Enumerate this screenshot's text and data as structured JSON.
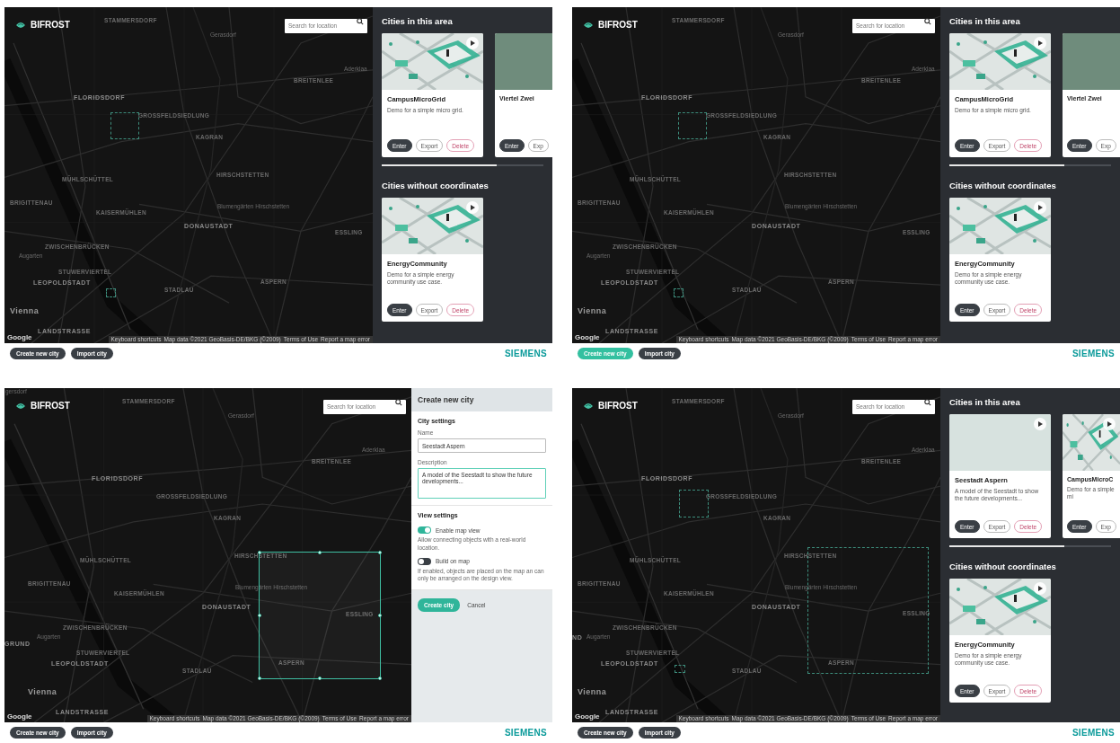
{
  "panels": [
    {
      "logo": "BIFROST",
      "search": {
        "placeholder": "Search for location"
      },
      "map": {
        "labels": [
          {
            "text": "STAMMERSDORF",
            "kind": "area"
          },
          {
            "text": "Gerasdorf",
            "kind": "town"
          },
          {
            "text": "Aderklaa",
            "kind": "town"
          },
          {
            "text": "BREITENLEE",
            "kind": "area"
          },
          {
            "text": "FLORIDSDORF",
            "kind": "district"
          },
          {
            "text": "GROSSFELDSIEDLUNG",
            "kind": "area"
          },
          {
            "text": "KAGRAN",
            "kind": "area"
          },
          {
            "text": "HIRSCHSTETTEN",
            "kind": "area"
          },
          {
            "text": "MÜHLSCHÜTTEL",
            "kind": "area"
          },
          {
            "text": "BRIGITTENAU",
            "kind": "area"
          },
          {
            "text": "KAISERMÜHLEN",
            "kind": "area"
          },
          {
            "text": "Blumengärten Hirschstetten",
            "kind": "town"
          },
          {
            "text": "DONAUSTADT",
            "kind": "district"
          },
          {
            "text": "ESSLING",
            "kind": "area"
          },
          {
            "text": "ZWISCHENBRÜCKEN",
            "kind": "area"
          },
          {
            "text": "Augarten",
            "kind": "town"
          },
          {
            "text": "STUWERVIERTEL",
            "kind": "area"
          },
          {
            "text": "LEOPOLDSTADT",
            "kind": "district"
          },
          {
            "text": "ASPERN",
            "kind": "area"
          },
          {
            "text": "STADLAU",
            "kind": "area"
          },
          {
            "text": "Vienna",
            "kind": "city"
          },
          {
            "text": "LANDSTRASSE",
            "kind": "district"
          }
        ],
        "areas": [
          {
            "kind": "dashed"
          },
          {
            "kind": "dashed"
          }
        ],
        "google": "Google",
        "attribution": [
          "Keyboard shortcuts",
          "Map data ©2021 GeoBasis-DE/BKG (©2009)",
          "Terms of Use",
          "Report a map error"
        ]
      },
      "sidebar": {
        "kind": "cities",
        "sections": [
          {
            "title": "Cities in this area",
            "cards": [
              {
                "title": "CampusMicroGrid",
                "description": "Demo for a simple micro grid.",
                "kind": "isometric",
                "peek": false,
                "buttons": [
                  {
                    "label": "Enter",
                    "kind": "primary"
                  },
                  {
                    "label": "Export",
                    "kind": "outline"
                  },
                  {
                    "label": "Delete",
                    "kind": "danger"
                  }
                ]
              },
              {
                "title": "Viertel Zwei",
                "kind": "solid",
                "peek": true,
                "buttons": [
                  {
                    "label": "Enter",
                    "kind": "primary"
                  },
                  {
                    "label": "Exp",
                    "kind": "outline"
                  }
                ]
              }
            ]
          },
          {
            "title": "Cities without coordinates",
            "cards": [
              {
                "title": "EnergyCommunity",
                "description": "Demo for a simple energy community use case.",
                "kind": "isometric",
                "peek": false,
                "buttons": [
                  {
                    "label": "Enter",
                    "kind": "primary"
                  },
                  {
                    "label": "Export",
                    "kind": "outline"
                  },
                  {
                    "label": "Delete",
                    "kind": "danger"
                  }
                ]
              }
            ]
          }
        ]
      },
      "footer": {
        "buttons": [
          {
            "label": "Create new city",
            "highlighted": false
          },
          {
            "label": "Import city",
            "highlighted": false
          }
        ],
        "brand": "SIEMENS"
      }
    },
    {
      "logo": "BIFROST",
      "search": {
        "placeholder": "Search for location"
      },
      "map": {
        "labels": [
          {
            "text": "STAMMERSDORF",
            "kind": "area"
          },
          {
            "text": "Gerasdorf",
            "kind": "town"
          },
          {
            "text": "Aderklaa",
            "kind": "town"
          },
          {
            "text": "BREITENLEE",
            "kind": "area"
          },
          {
            "text": "FLORIDSDORF",
            "kind": "district"
          },
          {
            "text": "GROSSFELDSIEDLUNG",
            "kind": "area"
          },
          {
            "text": "KAGRAN",
            "kind": "area"
          },
          {
            "text": "HIRSCHSTETTEN",
            "kind": "area"
          },
          {
            "text": "MÜHLSCHÜTTEL",
            "kind": "area"
          },
          {
            "text": "BRIGITTENAU",
            "kind": "area"
          },
          {
            "text": "KAISERMÜHLEN",
            "kind": "area"
          },
          {
            "text": "Blumengärten Hirschstetten",
            "kind": "town"
          },
          {
            "text": "DONAUSTADT",
            "kind": "district"
          },
          {
            "text": "ESSLING",
            "kind": "area"
          },
          {
            "text": "ZWISCHENBRÜCKEN",
            "kind": "area"
          },
          {
            "text": "Augarten",
            "kind": "town"
          },
          {
            "text": "STUWERVIERTEL",
            "kind": "area"
          },
          {
            "text": "LEOPOLDSTADT",
            "kind": "district"
          },
          {
            "text": "ASPERN",
            "kind": "area"
          },
          {
            "text": "STADLAU",
            "kind": "area"
          },
          {
            "text": "Vienna",
            "kind": "city"
          },
          {
            "text": "LANDSTRASSE",
            "kind": "district"
          }
        ],
        "areas": [
          {
            "kind": "dashed"
          },
          {
            "kind": "dashed"
          }
        ],
        "google": "Google",
        "attribution": [
          "Keyboard shortcuts",
          "Map data ©2021 GeoBasis-DE/BKG (©2009)",
          "Terms of Use",
          "Report a map error"
        ]
      },
      "sidebar": {
        "kind": "cities",
        "sections": [
          {
            "title": "Cities in this area",
            "cards": [
              {
                "title": "CampusMicroGrid",
                "description": "Demo for a simple micro grid.",
                "kind": "isometric",
                "peek": false,
                "buttons": [
                  {
                    "label": "Enter",
                    "kind": "primary"
                  },
                  {
                    "label": "Export",
                    "kind": "outline"
                  },
                  {
                    "label": "Delete",
                    "kind": "danger"
                  }
                ]
              },
              {
                "title": "Viertel Zwei",
                "kind": "solid",
                "peek": true,
                "buttons": [
                  {
                    "label": "Enter",
                    "kind": "primary"
                  },
                  {
                    "label": "Exp",
                    "kind": "outline"
                  }
                ]
              }
            ]
          },
          {
            "title": "Cities without coordinates",
            "cards": [
              {
                "title": "EnergyCommunity",
                "description": "Demo for a simple energy community use case.",
                "kind": "isometric",
                "peek": false,
                "buttons": [
                  {
                    "label": "Enter",
                    "kind": "primary"
                  },
                  {
                    "label": "Export",
                    "kind": "outline"
                  },
                  {
                    "label": "Delete",
                    "kind": "danger"
                  }
                ]
              }
            ]
          }
        ]
      },
      "footer": {
        "buttons": [
          {
            "label": "Create new city",
            "highlighted": true
          },
          {
            "label": "Import city",
            "highlighted": false
          }
        ],
        "brand": "SIEMENS"
      }
    },
    {
      "logo": "BIFROST",
      "search": {
        "placeholder": "Search for location"
      },
      "map": {
        "labels": [
          {
            "text": "gersdorf",
            "kind": "town"
          },
          {
            "text": "STAMMERSDORF",
            "kind": "area"
          },
          {
            "text": "Gerasdorf",
            "kind": "town"
          },
          {
            "text": "Aderklaa",
            "kind": "town"
          },
          {
            "text": "BREITENLEE",
            "kind": "area"
          },
          {
            "text": "FLORIDSDORF",
            "kind": "district"
          },
          {
            "text": "GROSSFELDSIEDLUNG",
            "kind": "area"
          },
          {
            "text": "KAGRAN",
            "kind": "area"
          },
          {
            "text": "HIRSCHSTETTEN",
            "kind": "area"
          },
          {
            "text": "MÜHLSCHÜTTEL",
            "kind": "area"
          },
          {
            "text": "BRIGITTENAU",
            "kind": "area"
          },
          {
            "text": "KAISERMÜHLEN",
            "kind": "area"
          },
          {
            "text": "Blumengärten Hirschstetten",
            "kind": "town"
          },
          {
            "text": "DONAUSTADT",
            "kind": "district"
          },
          {
            "text": "ESSLING",
            "kind": "area"
          },
          {
            "text": "ZWISCHENBRÜCKEN",
            "kind": "area"
          },
          {
            "text": "GRUND",
            "kind": "district"
          },
          {
            "text": "Augarten",
            "kind": "town"
          },
          {
            "text": "STUWERVIERTEL",
            "kind": "area"
          },
          {
            "text": "LEOPOLDSTADT",
            "kind": "district"
          },
          {
            "text": "ASPERN",
            "kind": "area"
          },
          {
            "text": "STADLAU",
            "kind": "area"
          },
          {
            "text": "Vienna",
            "kind": "city"
          },
          {
            "text": "LANDSTRASSE",
            "kind": "district"
          }
        ],
        "areas": [
          {
            "kind": "selected"
          }
        ],
        "google": "Google",
        "attribution": [
          "Keyboard shortcuts",
          "Map data ©2021 GeoBasis-DE/BKG (©2009)",
          "Terms of Use",
          "Report a map error"
        ]
      },
      "sidebar": {
        "kind": "form",
        "title": "Create new city",
        "settings_title": "City settings",
        "name": {
          "label": "Name",
          "value": "Seestadt Aspern"
        },
        "description": {
          "label": "Description",
          "value": "A model of the Seestadt to show the future developments...",
          "focused": true
        },
        "view_title": "View settings",
        "toggles": [
          {
            "label": "Enable map view",
            "hint": "Allow connecting objects with a real-world location.",
            "on": true
          },
          {
            "label": "Build on map",
            "hint": "If enabled, objects are placed on the map an can only be arranged on the design view.",
            "on": false
          }
        ],
        "submit": "Create city",
        "cancel": "Cancel"
      },
      "footer": {
        "buttons": [
          {
            "label": "Create new city",
            "highlighted": false
          },
          {
            "label": "Import city",
            "highlighted": false
          }
        ],
        "brand": "SIEMENS"
      }
    },
    {
      "logo": "BIFROST",
      "search": {
        "placeholder": "Search for location"
      },
      "map": {
        "labels": [
          {
            "text": "STAMMERSDORF",
            "kind": "area"
          },
          {
            "text": "Gerasdorf",
            "kind": "town"
          },
          {
            "text": "Aderklaa",
            "kind": "town"
          },
          {
            "text": "BREITENLEE",
            "kind": "area"
          },
          {
            "text": "FLORIDSDORF",
            "kind": "district"
          },
          {
            "text": "GROSSFELDSIEDLUNG",
            "kind": "area"
          },
          {
            "text": "KAGRAN",
            "kind": "area"
          },
          {
            "text": "HIRSCHSTETTEN",
            "kind": "area"
          },
          {
            "text": "MÜHLSCHÜTTEL",
            "kind": "area"
          },
          {
            "text": "BRIGITTENAU",
            "kind": "area"
          },
          {
            "text": "KAISERMÜHLEN",
            "kind": "area"
          },
          {
            "text": "Blumengärten Hirschstetten",
            "kind": "town"
          },
          {
            "text": "DONAUSTADT",
            "kind": "district"
          },
          {
            "text": "ESSLING",
            "kind": "area"
          },
          {
            "text": "ZWISCHENBRÜCKEN",
            "kind": "area"
          },
          {
            "text": "ND",
            "kind": "district"
          },
          {
            "text": "Augarten",
            "kind": "town"
          },
          {
            "text": "STUWERVIERTEL",
            "kind": "area"
          },
          {
            "text": "LEOPOLDSTADT",
            "kind": "district"
          },
          {
            "text": "ASPERN",
            "kind": "area"
          },
          {
            "text": "STADLAU",
            "kind": "area"
          },
          {
            "text": "Vienna",
            "kind": "city"
          },
          {
            "text": "LANDSTRASSE",
            "kind": "district"
          }
        ],
        "areas": [
          {
            "kind": "dashed"
          },
          {
            "kind": "dashed"
          },
          {
            "kind": "dashed"
          }
        ],
        "google": "Google",
        "attribution": [
          "Keyboard shortcuts",
          "Map data ©2021 GeoBasis-DE/BKG (©2009)",
          "Terms of Use",
          "Report a map error"
        ]
      },
      "sidebar": {
        "kind": "cities",
        "sections": [
          {
            "title": "Cities in this area",
            "cards": [
              {
                "title": "Seestadt Aspern",
                "description": "A model of the Seestadt to show the future developments...",
                "kind": "blank",
                "peek": false,
                "buttons": [
                  {
                    "label": "Enter",
                    "kind": "primary"
                  },
                  {
                    "label": "Export",
                    "kind": "outline"
                  },
                  {
                    "label": "Delete",
                    "kind": "danger"
                  }
                ]
              },
              {
                "title": "CampusMicroC",
                "description": "Demo for a simple mi",
                "kind": "isometric",
                "peek": true,
                "buttons": [
                  {
                    "label": "Enter",
                    "kind": "primary"
                  },
                  {
                    "label": "Exp",
                    "kind": "outline"
                  }
                ]
              }
            ]
          },
          {
            "title": "Cities without coordinates",
            "cards": [
              {
                "title": "EnergyCommunity",
                "description": "Demo for a simple energy community use case.",
                "kind": "isometric",
                "peek": false,
                "buttons": [
                  {
                    "label": "Enter",
                    "kind": "primary"
                  },
                  {
                    "label": "Export",
                    "kind": "outline"
                  },
                  {
                    "label": "Delete",
                    "kind": "danger"
                  }
                ]
              }
            ]
          }
        ]
      },
      "footer": {
        "buttons": [
          {
            "label": "Create new city",
            "highlighted": false
          },
          {
            "label": "Import city",
            "highlighted": false
          }
        ],
        "brand": "SIEMENS"
      }
    }
  ]
}
